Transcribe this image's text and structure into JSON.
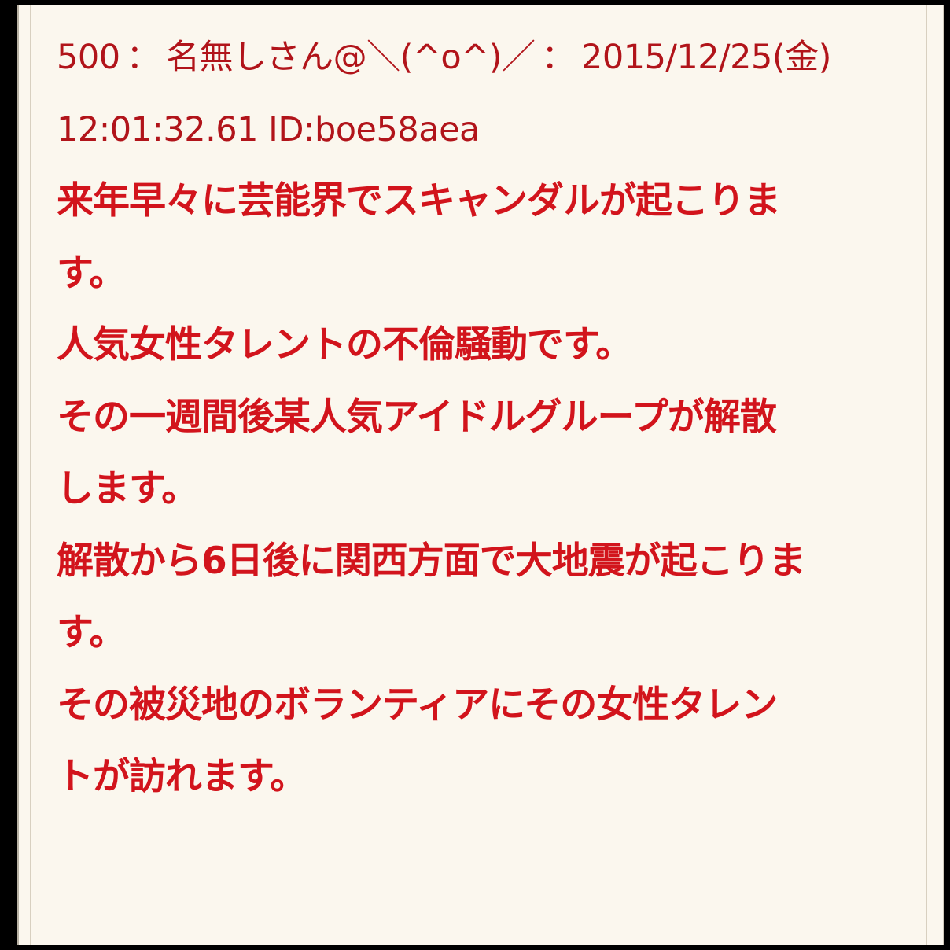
{
  "post": {
    "number": "500",
    "separator": "：",
    "name": "名無しさん@＼(^o^)／",
    "date": "2015/12/25(金)",
    "time_and_id": "12:01:32.61 ID:boe58aea",
    "body_lines": [
      "来年早々に芸能界でスキャンダルが起こりま",
      "す。",
      "人気女性タレントの不倫騒動です。",
      "その一週間後某人気アイドルグループが解散",
      "します。",
      "解散から6日後に関西方面で大地震が起こりま",
      "す。",
      "その被災地のボランティアにその女性タレン",
      "トが訪れます。"
    ]
  },
  "colors": {
    "header_text": "#b1141a",
    "body_text": "#d2141c",
    "background": "#fbf7ee",
    "frame": "#000000"
  }
}
